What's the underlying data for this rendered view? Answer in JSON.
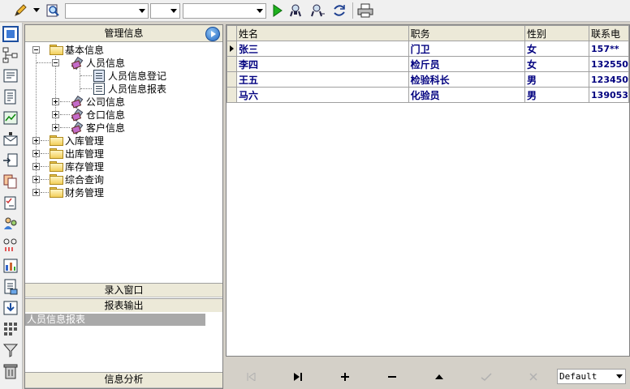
{
  "toolbar": {
    "combo1_value": "",
    "combo2_value": "",
    "combo3_value": "",
    "icons": [
      "pencil-icon",
      "dropdown-arrow-icon",
      "preview-icon",
      "run-icon",
      "find-icon",
      "find-next-icon",
      "refresh-icon",
      "print-icon"
    ]
  },
  "sidebar_icons": [
    "window-icon",
    "structure-icon",
    "form-icon",
    "document-icon",
    "chart-icon",
    "mail-icon",
    "export-icon",
    "copy-icon",
    "checklist-icon",
    "users-icon",
    "link-icon",
    "report-icon",
    "page-icon",
    "import-icon",
    "grid-icon",
    "filter-icon",
    "trash-icon"
  ],
  "panel": {
    "title": "管理信息",
    "tree": {
      "root": "基本信息",
      "personnel": "人员信息",
      "personnel_register": "人员信息登记",
      "personnel_report": "人员信息报表",
      "company": "公司信息",
      "warehouse": "仓口信息",
      "customer": "客户信息",
      "inbound": "入库管理",
      "outbound": "出库管理",
      "inventory": "库存管理",
      "query": "综合查询",
      "finance": "财务管理"
    },
    "sections": {
      "entry": "录入窗口",
      "report": "报表输出",
      "analysis": "信息分析"
    },
    "report_items": [
      "人员信息报表"
    ]
  },
  "grid": {
    "columns": [
      "姓名",
      "职务",
      "性别",
      "联系电"
    ],
    "rows": [
      {
        "name": "张三",
        "position": "门卫",
        "gender": "女",
        "phone": "157**"
      },
      {
        "name": "李四",
        "position": "检斤员",
        "gender": "女",
        "phone": "132550"
      },
      {
        "name": "王五",
        "position": "检验科长",
        "gender": "男",
        "phone": "123450"
      },
      {
        "name": "马六",
        "position": "化验员",
        "gender": "男",
        "phone": "139053"
      }
    ]
  },
  "navigator": {
    "buttons": [
      "first",
      "last",
      "insert",
      "delete",
      "edit",
      "post",
      "cancel"
    ],
    "select_value": "Default"
  }
}
